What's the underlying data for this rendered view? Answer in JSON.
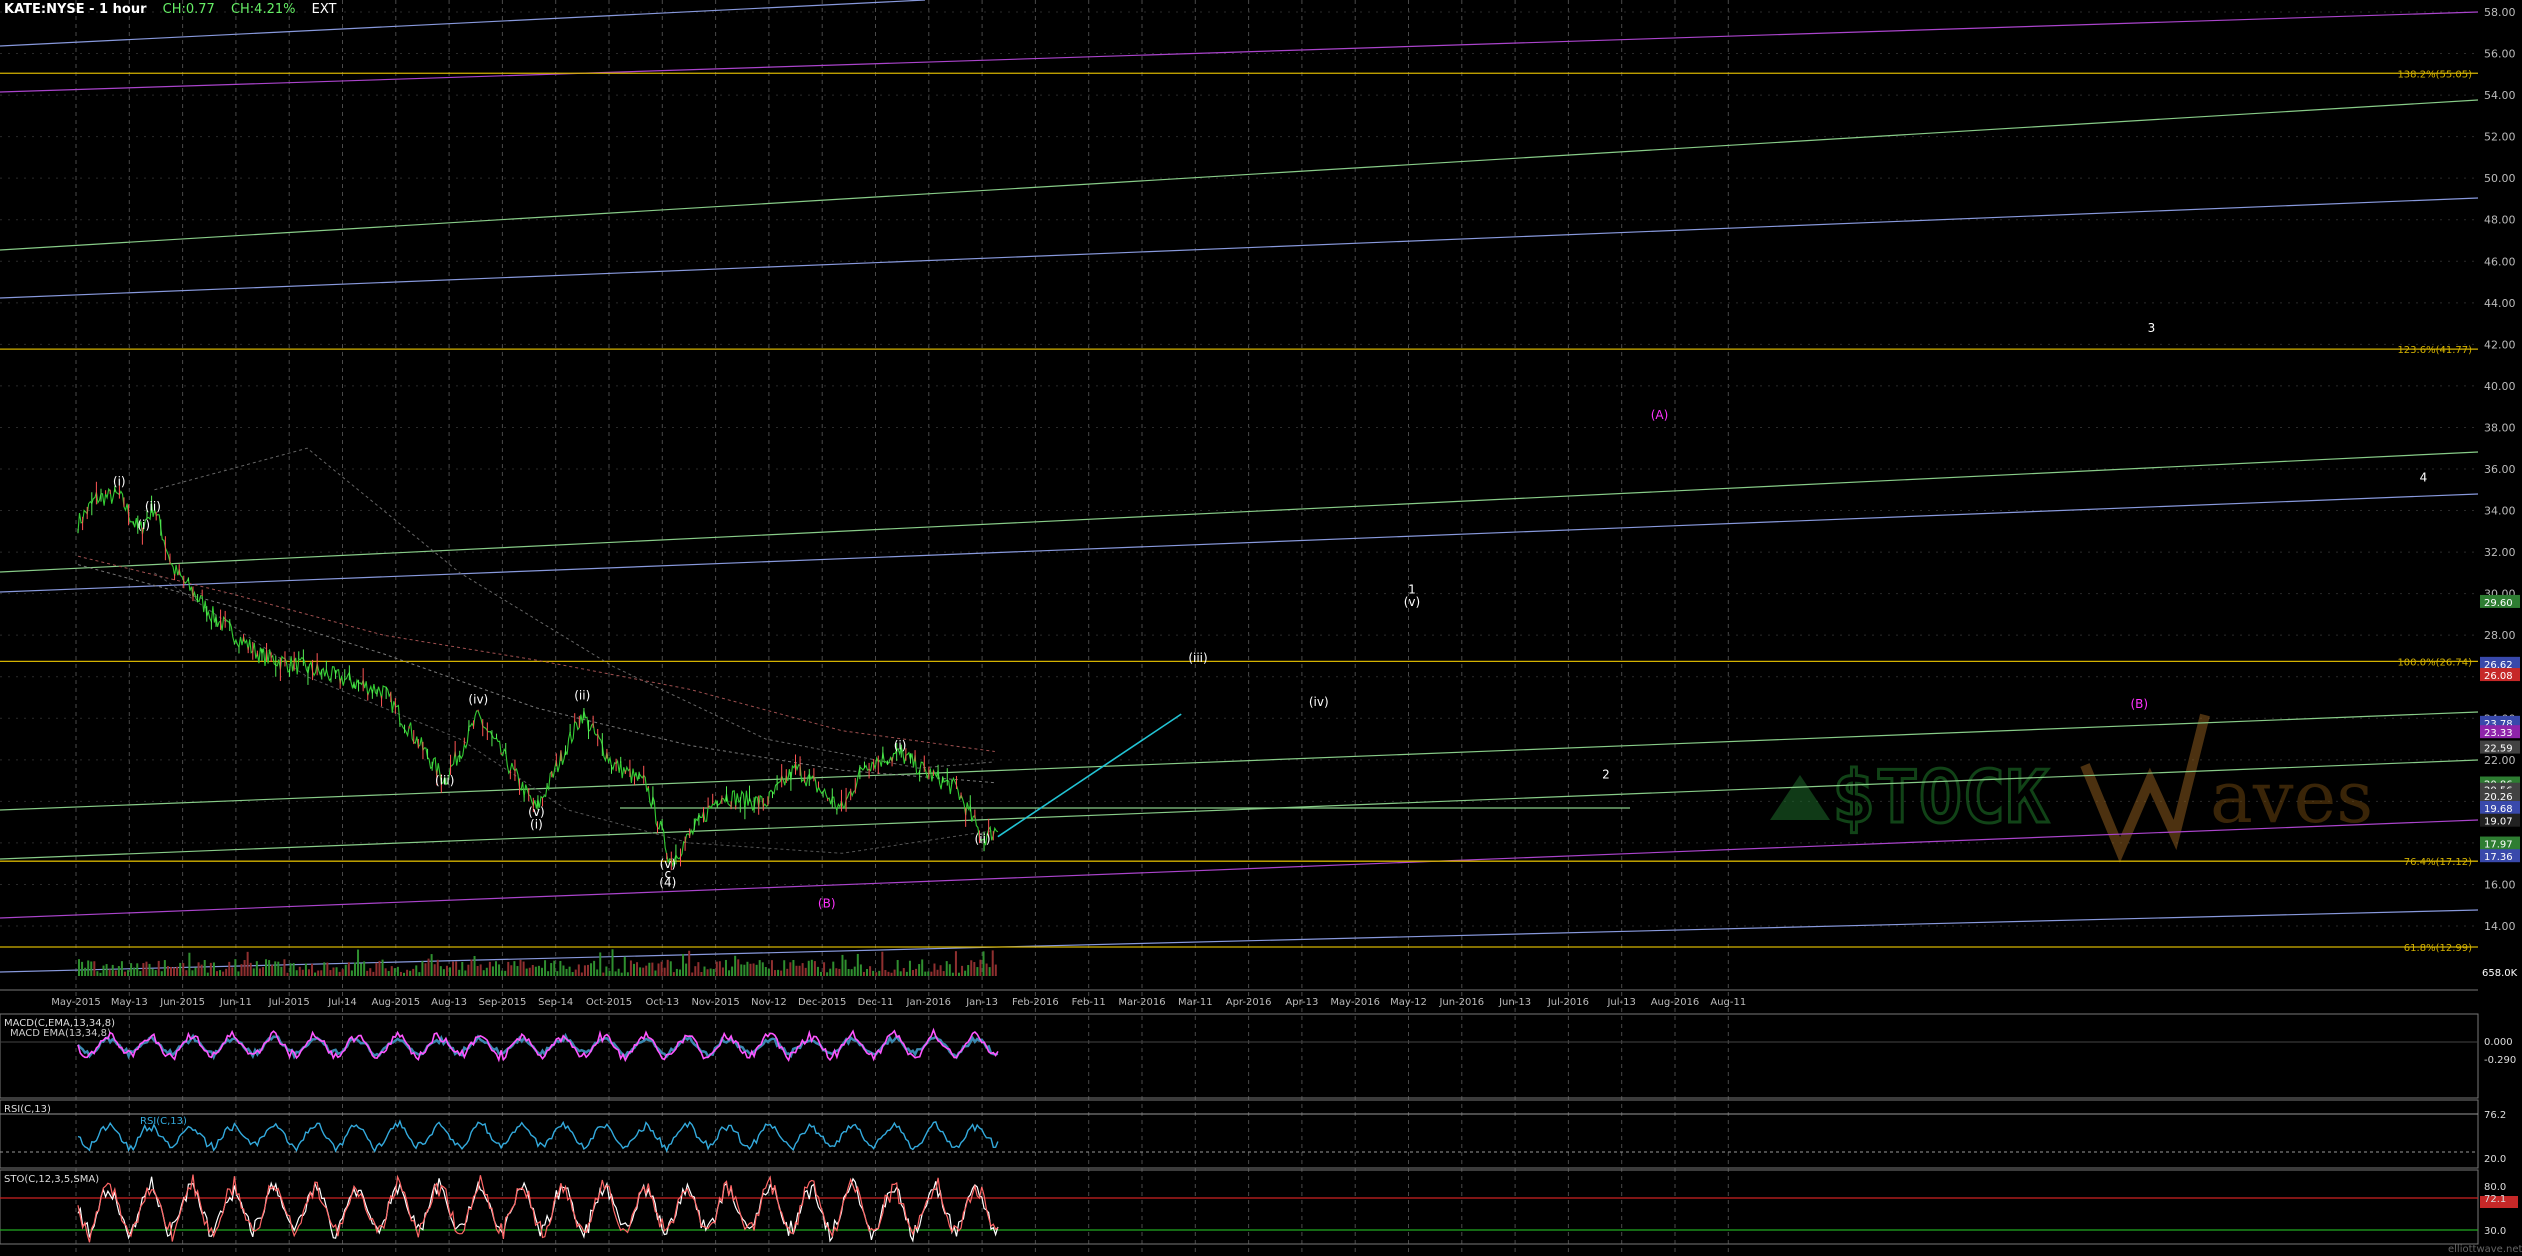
{
  "header": {
    "symbol": "KATE:NYSE - 1 hour",
    "change": "CH:0.77",
    "change_pct": "CH:4.21%",
    "session": "EXT"
  },
  "colors": {
    "background": "#000000",
    "price": "#33cc33",
    "fib": "#d4b200",
    "channel_blue": "#8899dd",
    "channel_green": "#88cc88",
    "channel_purple": "#aa44cc",
    "arrow": "#22c4d4",
    "wave_label": "#ffffff",
    "wave_label_magenta": "#ff33ff",
    "macd": "#ff55ff",
    "rsi": "#33aadd",
    "stoch_fast": "#ff6666",
    "stoch_slow": "#ffffff"
  },
  "main_axis": {
    "ticks": [
      "58.00",
      "56.00",
      "54.00",
      "52.00",
      "50.00",
      "48.00",
      "46.00",
      "44.00",
      "42.00",
      "40.00",
      "38.00",
      "36.00",
      "34.00",
      "32.00",
      "30.00",
      "28.00",
      "26.00",
      "24.00",
      "22.00",
      "20.00",
      "18.00",
      "16.00",
      "14.00"
    ]
  },
  "fib_levels": [
    {
      "label": "138.2%(55.05)",
      "value": 55.05
    },
    {
      "label": "123.6%(41.77)",
      "value": 41.77
    },
    {
      "label": "100.0%(26.74)",
      "value": 26.74
    },
    {
      "label": "76.4%(17.12)",
      "value": 17.12
    },
    {
      "label": "61.8%(12.99)",
      "value": 12.99
    }
  ],
  "price_tags": [
    {
      "label": "29.60",
      "value": 29.6,
      "color": "#2e7d32"
    },
    {
      "label": "26.62",
      "value": 26.62,
      "color": "#3949ab"
    },
    {
      "label": "26.08",
      "value": 26.08,
      "color": "#c62828"
    },
    {
      "label": "23.78",
      "value": 23.78,
      "color": "#3949ab"
    },
    {
      "label": "23.33",
      "value": 23.33,
      "color": "#8e24aa"
    },
    {
      "label": "22.59",
      "value": 22.59,
      "color": "#424242"
    },
    {
      "label": "20.86",
      "value": 20.86,
      "color": "#2e7d32"
    },
    {
      "label": "20.56",
      "value": 20.56,
      "color": "#424242"
    },
    {
      "label": "20.26",
      "value": 20.26,
      "color": "#424242"
    },
    {
      "label": "19.68",
      "value": 19.68,
      "color": "#3949ab"
    },
    {
      "label": "19.07",
      "value": 19.07,
      "color": "#212121"
    },
    {
      "label": "17.97",
      "value": 17.97,
      "color": "#2e7d32"
    },
    {
      "label": "17.36",
      "value": 17.36,
      "color": "#3949ab"
    }
  ],
  "volume_tag": "658.0K",
  "time_axis": [
    "May-2015",
    "May-13",
    "Jun-2015",
    "Jun-11",
    "Jul-2015",
    "Jul-14",
    "Aug-2015",
    "Aug-13",
    "Sep-2015",
    "Sep-14",
    "Oct-2015",
    "Oct-13",
    "Nov-2015",
    "Nov-12",
    "Dec-2015",
    "Dec-11",
    "Jan-2016",
    "Jan-13",
    "Feb-2016",
    "Feb-11",
    "Mar-2016",
    "Mar-11",
    "Apr-2016",
    "Apr-13",
    "May-2016",
    "May-12",
    "Jun-2016",
    "Jun-13",
    "Jul-2016",
    "Jul-13",
    "Aug-2016",
    "Aug-11"
  ],
  "wave_labels": [
    {
      "text": "(i)",
      "t": 0.027,
      "v": 35.2,
      "color": "#ffffff"
    },
    {
      "text": "(ii)",
      "t": 0.049,
      "v": 34.0,
      "color": "#ffffff"
    },
    {
      "text": "(i)",
      "t": 0.043,
      "v": 33.1,
      "color": "#ffffff"
    },
    {
      "text": "(iv)",
      "t": 0.262,
      "v": 24.7,
      "color": "#ffffff"
    },
    {
      "text": "(iii)",
      "t": 0.24,
      "v": 20.8,
      "color": "#ffffff"
    },
    {
      "text": "(v)",
      "t": 0.3,
      "v": 19.3,
      "color": "#ffffff"
    },
    {
      "text": "(i)",
      "t": 0.3,
      "v": 18.7,
      "color": "#ffffff"
    },
    {
      "text": "(ii)",
      "t": 0.33,
      "v": 24.9,
      "color": "#ffffff"
    },
    {
      "text": "(v)",
      "t": 0.386,
      "v": 16.8,
      "color": "#ffffff"
    },
    {
      "text": "c",
      "t": 0.386,
      "v": 16.3,
      "color": "#ffffff"
    },
    {
      "text": "(4)",
      "t": 0.386,
      "v": 15.9,
      "color": "#ffffff"
    },
    {
      "text": "(i)",
      "t": 0.538,
      "v": 22.5,
      "color": "#ffffff"
    },
    {
      "text": "(ii)",
      "t": 0.592,
      "v": 18.0,
      "color": "#ffffff"
    },
    {
      "text": "(iii)",
      "t": 0.733,
      "v": 26.7,
      "color": "#ffffff"
    },
    {
      "text": "(iv)",
      "t": 0.812,
      "v": 24.6,
      "color": "#ffffff"
    },
    {
      "text": "1",
      "t": 0.873,
      "v": 30.0,
      "color": "#ffffff"
    },
    {
      "text": "(v)",
      "t": 0.873,
      "v": 29.4,
      "color": "#ffffff"
    },
    {
      "text": "2",
      "t": 1.0,
      "v": 21.1,
      "color": "#ffffff"
    },
    {
      "text": "3",
      "t": 1.357,
      "v": 42.6,
      "color": "#ffffff"
    },
    {
      "text": "4",
      "t": 1.535,
      "v": 35.4,
      "color": "#ffffff"
    },
    {
      "text": "(A)",
      "t": 1.035,
      "v": 38.4,
      "color": "#ff33ff"
    },
    {
      "text": "(B)",
      "t": 1.349,
      "v": 24.5,
      "color": "#ff33ff"
    },
    {
      "text": "(B)",
      "t": 0.49,
      "v": 14.9,
      "color": "#ff33ff"
    }
  ],
  "macd": {
    "title": "MACD(C,EMA,13,34,8)",
    "sub": "MACD EMA(13,34,8)",
    "ticks": [
      "0.000",
      "-0.290"
    ]
  },
  "rsi": {
    "title": "RSI(C,13)",
    "sub": "RSI(C,13)",
    "ticks": [
      "76.2",
      "20.0"
    ]
  },
  "stoch": {
    "title": "STO(C,12,3,5,SMA)",
    "ticks": [
      "80.0",
      "72.1",
      "30.0"
    ]
  },
  "watermark": {
    "left": "$TOCK",
    "right": "aves"
  },
  "credit": "elliottwave.net"
}
